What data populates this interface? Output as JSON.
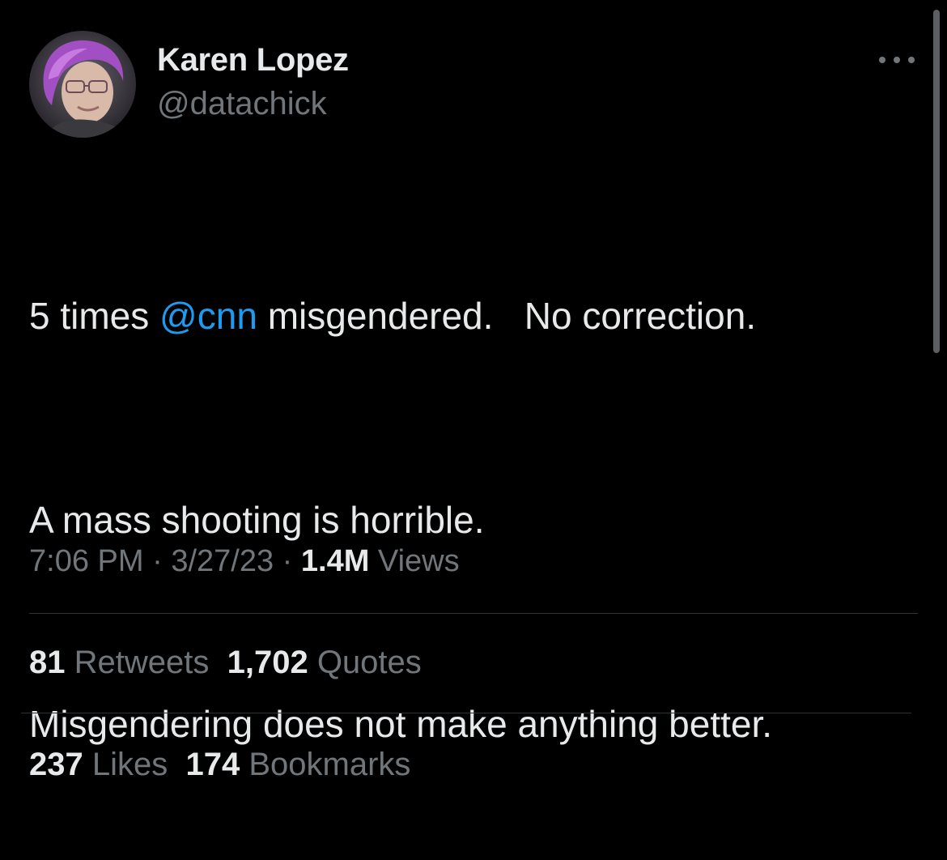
{
  "author": {
    "name": "Karen Lopez",
    "handle": "@datachick"
  },
  "tweet": {
    "line1_prefix": "5 times ",
    "line1_mention": "@cnn",
    "line1_suffix": " misgendered.   No correction.",
    "line2": "A mass shooting is horrible.",
    "line3": "Misgendering does not make anything better."
  },
  "meta": {
    "time": "7:06 PM",
    "sep1": " · ",
    "date": "3/27/23",
    "sep2": " · ",
    "views_count": "1.4M",
    "views_label": " Views"
  },
  "stats": {
    "retweets_count": "81",
    "retweets_label": " Retweets",
    "quotes_count": "1,702",
    "quotes_label": " Quotes",
    "likes_count": "237",
    "likes_label": " Likes",
    "bookmarks_count": "174",
    "bookmarks_label": " Bookmarks"
  },
  "icons": {
    "more": "more-horizontal-icon"
  },
  "colors": {
    "background": "#000000",
    "text_primary": "#e7e9ea",
    "text_secondary": "#71767b",
    "link": "#1d9bf0",
    "divider": "#2f3336"
  }
}
